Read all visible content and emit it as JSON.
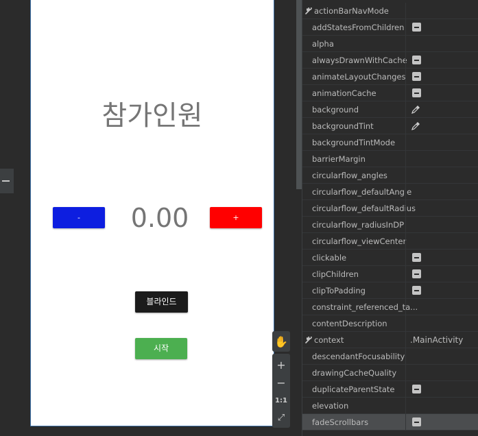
{
  "phone_preview": {
    "title": "참가인원",
    "minus_label": "-",
    "plus_label": "+",
    "value": "0.00",
    "blind_label": "블라인드",
    "start_label": "시작"
  },
  "zoom_tools": {
    "pan": "✋",
    "zoom_in": "+",
    "zoom_out": "−",
    "actual_size": "1:1",
    "fit": "⤢"
  },
  "attributes": [
    {
      "name": "actionBarNavMode",
      "value": "",
      "control": "wrench"
    },
    {
      "name": "addStatesFromChildren",
      "value": "",
      "control": "flag"
    },
    {
      "name": "alpha",
      "value": "",
      "control": ""
    },
    {
      "name": "alwaysDrawnWithCache",
      "value": "",
      "control": "flag"
    },
    {
      "name": "animateLayoutChanges",
      "value": "",
      "control": "flag"
    },
    {
      "name": "animationCache",
      "value": "",
      "control": "flag"
    },
    {
      "name": "background",
      "value": "",
      "control": "picker"
    },
    {
      "name": "backgroundTint",
      "value": "",
      "control": "picker"
    },
    {
      "name": "backgroundTintMode",
      "value": "",
      "control": ""
    },
    {
      "name": "barrierMargin",
      "value": "",
      "control": ""
    },
    {
      "name": "circularflow_angles",
      "value": "",
      "control": ""
    },
    {
      "name": "circularflow_defaultAngle",
      "value": "",
      "control": ""
    },
    {
      "name": "circularflow_defaultRadius",
      "value": "",
      "control": ""
    },
    {
      "name": "circularflow_radiusInDP",
      "value": "",
      "control": ""
    },
    {
      "name": "circularflow_viewCenter",
      "value": "",
      "control": ""
    },
    {
      "name": "clickable",
      "value": "",
      "control": "flag"
    },
    {
      "name": "clipChildren",
      "value": "",
      "control": "flag"
    },
    {
      "name": "clipToPadding",
      "value": "",
      "control": "flag"
    },
    {
      "name": "constraint_referenced_ta...",
      "value": "",
      "control": ""
    },
    {
      "name": "contentDescription",
      "value": "",
      "control": ""
    },
    {
      "name": "context",
      "value": ".MainActivity",
      "control": "wrench"
    },
    {
      "name": "descendantFocusability",
      "value": "",
      "control": ""
    },
    {
      "name": "drawingCacheQuality",
      "value": "",
      "control": ""
    },
    {
      "name": "duplicateParentState",
      "value": "",
      "control": "flag"
    },
    {
      "name": "elevation",
      "value": "",
      "control": ""
    },
    {
      "name": "fadeScrollbars",
      "value": "",
      "control": "flag"
    }
  ]
}
